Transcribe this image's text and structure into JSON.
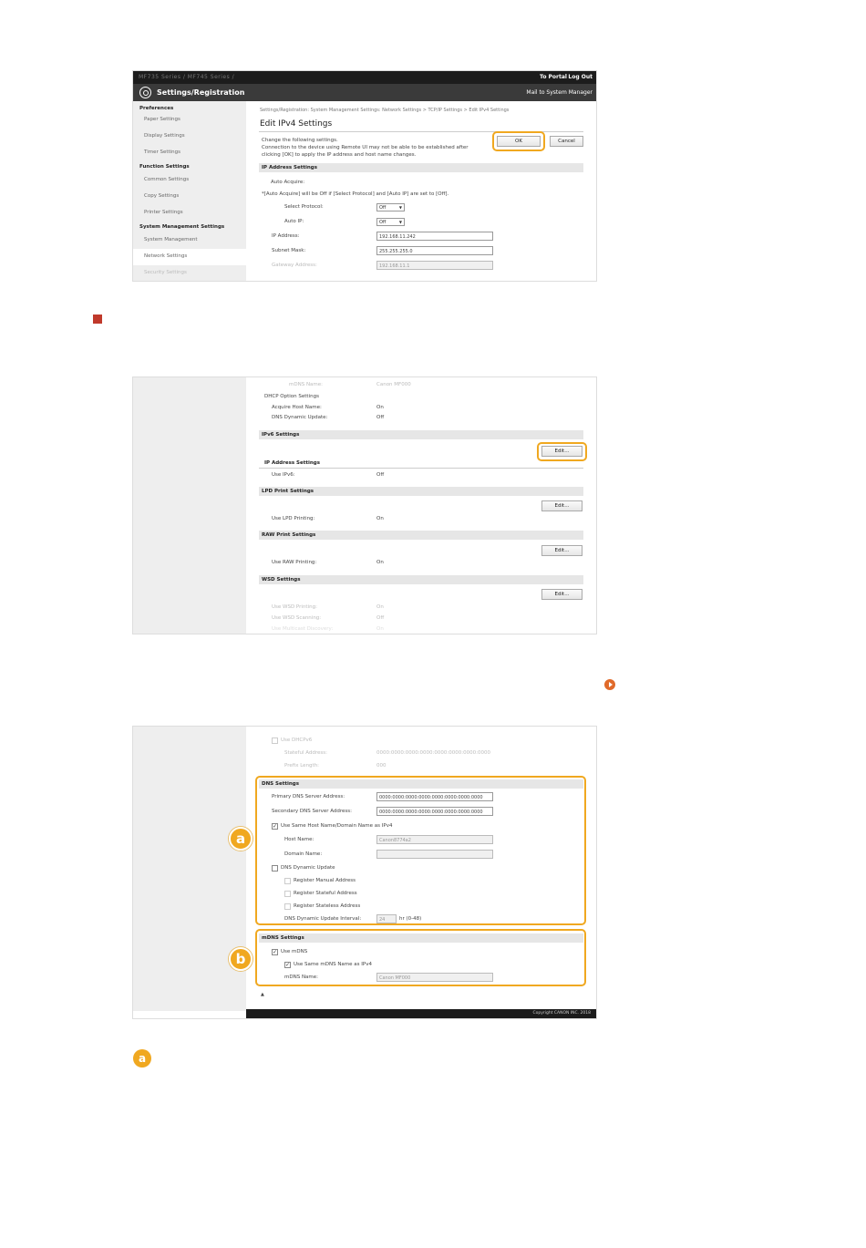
{
  "shot1": {
    "topbar": {
      "model": "MF735 Series / MF745 Series /",
      "portal": "To Portal",
      "logout": "Log Out"
    },
    "title": "Settings/Registration",
    "mail": "Mail to System Manager",
    "sidebar": [
      {
        "label": "Preferences",
        "kind": "hdr"
      },
      {
        "label": "Paper Settings",
        "kind": "sub"
      },
      {
        "label": "Display Settings",
        "kind": "sub"
      },
      {
        "label": "Timer Settings",
        "kind": "sub"
      },
      {
        "label": "Function Settings",
        "kind": "hdr"
      },
      {
        "label": "Common Settings",
        "kind": "sub"
      },
      {
        "label": "Copy Settings",
        "kind": "sub"
      },
      {
        "label": "Printer Settings",
        "kind": "sub"
      },
      {
        "label": "System Management Settings",
        "kind": "hdr"
      },
      {
        "label": "System Management",
        "kind": "sub"
      },
      {
        "label": "Network Settings",
        "kind": "sub active"
      },
      {
        "label": "Security Settings",
        "kind": "sub faded"
      }
    ],
    "breadcrumb": "Settings/Registration: System Management Settings: Network Settings > TCP/IP Settings > Edit IPv4 Settings",
    "page_title": "Edit IPv4 Settings",
    "desc": [
      "Change the following settings.",
      "Connection to the device using Remote UI may not be able to be established after",
      "clicking [OK] to apply the IP address and host name changes."
    ],
    "ok": "OK",
    "cancel": "Cancel",
    "section": "IP Address Settings",
    "auto_acquire": "Auto Acquire:",
    "auto_note": "*[Auto Acquire] will be Off if [Select Protocol] and [Auto IP] are set to [Off].",
    "select_protocol": {
      "label": "Select Protocol:",
      "value": "Off"
    },
    "auto_ip": {
      "label": "Auto IP:",
      "value": "Off"
    },
    "ip_address": {
      "label": "IP Address:",
      "value": "192.168.11.242"
    },
    "subnet": {
      "label": "Subnet Mask:",
      "value": "255.255.255.0"
    },
    "gateway": {
      "label": "Gateway Address:",
      "value": "192.168.11.1"
    }
  },
  "shot2": {
    "mdns_name": {
      "label": "mDNS Name:",
      "value": "Canon MF000"
    },
    "dhcp_option": "DHCP Option Settings",
    "acquire_host": {
      "label": "Acquire Host Name:",
      "value": "On"
    },
    "dns_dynamic": {
      "label": "DNS Dynamic Update:",
      "value": "Off"
    },
    "ipv6_section": "IPv6 Settings",
    "edit": "Edit...",
    "ip_addr_settings": "IP Address Settings",
    "use_ipv6": {
      "label": "Use IPv6:",
      "value": "Off"
    },
    "lpd_section": "LPD Print Settings",
    "use_lpd": {
      "label": "Use LPD Printing:",
      "value": "On"
    },
    "raw_section": "RAW Print Settings",
    "use_raw": {
      "label": "Use RAW Printing:",
      "value": "On"
    },
    "wsd_section": "WSD Settings",
    "use_wsd_print": {
      "label": "Use WSD Printing:",
      "value": "On"
    },
    "use_wsd_scan": {
      "label": "Use WSD Scanning:",
      "value": "Off"
    },
    "use_multicast": {
      "label": "Use Multicast Discovery:",
      "value": "On"
    }
  },
  "shot3": {
    "use_dhcpv6": "Use DHCPv6",
    "stateful": {
      "label": "Stateful Address:",
      "value": "0000:0000:0000:0000:0000:0000:0000:0000"
    },
    "prefix": {
      "label": "Prefix Length:",
      "value": "000"
    },
    "dns_section": "DNS Settings",
    "primary_dns": {
      "label": "Primary DNS Server Address:",
      "value": "0000:0000:0000:0000:0000:0000:0000:0000"
    },
    "secondary_dns": {
      "label": "Secondary DNS Server Address:",
      "value": "0000:0000:0000:0000:0000:0000:0000:0000"
    },
    "use_same_host": "Use Same Host Name/Domain Name as IPv4",
    "host_name": {
      "label": "Host Name:",
      "value": "Canon8774a2"
    },
    "domain_name": {
      "label": "Domain Name:",
      "value": ""
    },
    "dns_dyn_update": "DNS Dynamic Update",
    "reg_manual": "Register Manual Address",
    "reg_stateful": "Register Stateful Address",
    "reg_stateless": "Register Stateless Address",
    "dns_interval": {
      "label": "DNS Dynamic Update Interval:",
      "value": "24",
      "unit": "hr (0-48)"
    },
    "mdns_section": "mDNS Settings",
    "use_mdns": "Use mDNS",
    "use_same_mdns": "Use Same mDNS Name as IPv4",
    "mdns_name": {
      "label": "mDNS Name:",
      "value": "Canon MF000"
    },
    "top_link": "▲",
    "copyright": "Copyright CANON INC. 2018",
    "callout_a": "a",
    "callout_b": "b"
  },
  "bottom_callout": "a",
  "colors": {
    "highlight": "#f0a820",
    "marker": "#c0392b",
    "link": "#e06a2a",
    "header_bg": "#1c1c1c"
  }
}
